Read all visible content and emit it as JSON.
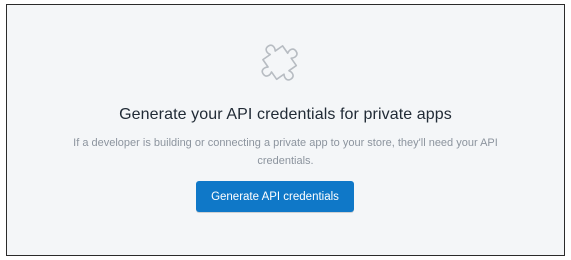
{
  "empty_state": {
    "icon": "puzzle-piece-icon",
    "heading": "Generate your API credentials for private apps",
    "description": "If a developer is building or connecting a private app to your store, they'll need your API credentials.",
    "button_label": "Generate API credentials"
  },
  "colors": {
    "background": "#f4f6f8",
    "button": "#0f78c8",
    "heading": "#212b36",
    "description": "#8c949e",
    "icon_stroke": "#b7bcc2"
  }
}
